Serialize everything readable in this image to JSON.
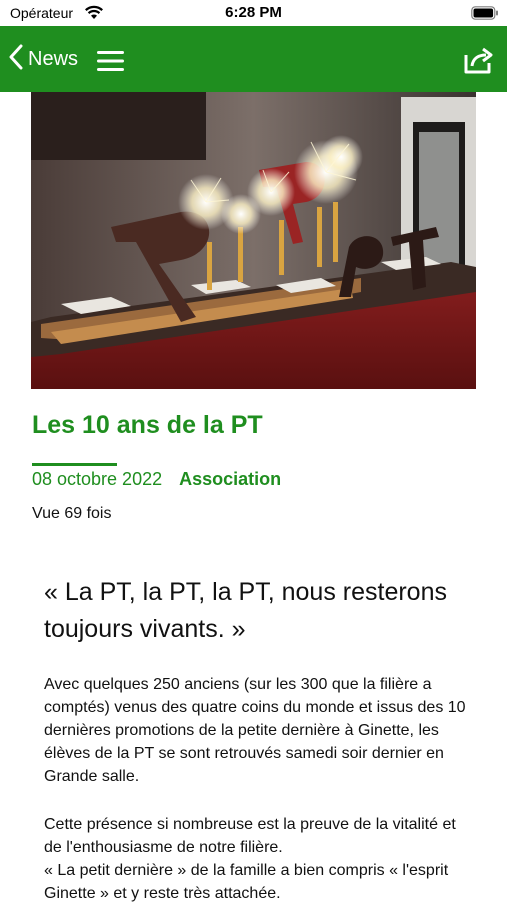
{
  "status_bar": {
    "carrier": "Opérateur",
    "time": "6:28 PM"
  },
  "nav": {
    "back_label": "News",
    "accent_color": "#1f8e1f"
  },
  "article": {
    "title": "Les 10 ans de la PT",
    "date": "08 octobre 2022",
    "category": "Association",
    "views": "Vue 69 fois",
    "quote": "« La PT, la PT, la PT, nous resterons toujours vivants. »",
    "paragraph_1": "Avec quelques 250 anciens (sur les 300 que la filière a comptés) venus des quatre coins du monde et issus des 10 dernières promotions de la petite dernière à Ginette, les élèves de la PT se sont retrouvés samedi soir dernier en Grande salle.",
    "paragraph_2_line_1": "Cette présence si nombreuse est la preuve de la vitalité et de l'enthousiasme de notre filière.",
    "paragraph_2_line_2": "« La petit dernière » de la famille a bien compris « l'esprit Ginette » et y reste très attachée."
  }
}
